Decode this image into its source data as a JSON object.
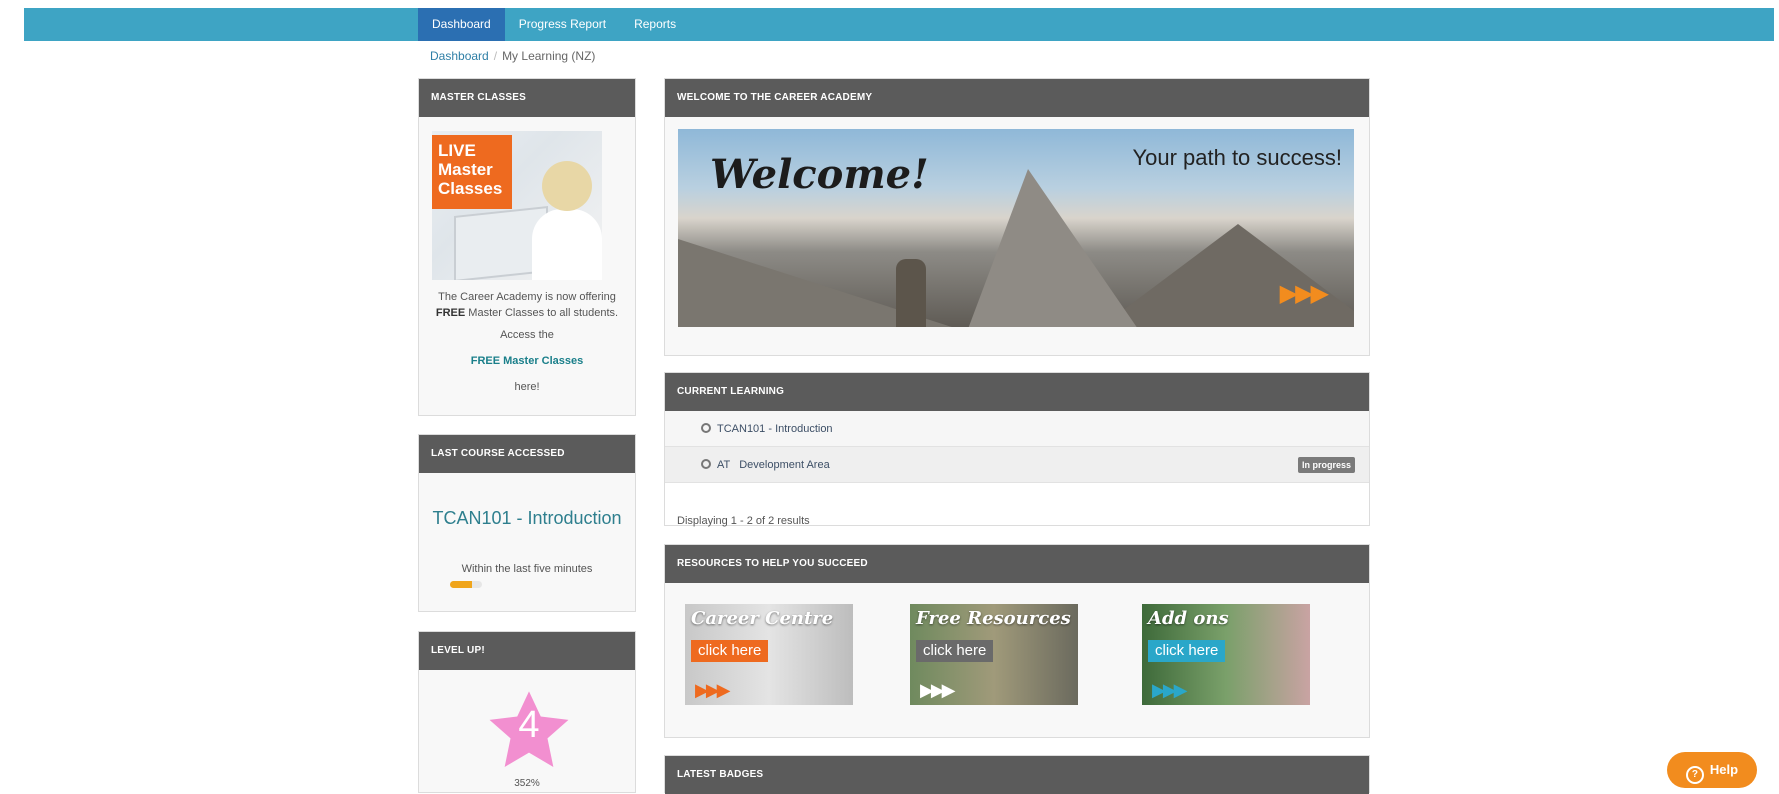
{
  "nav": {
    "items": [
      "Dashboard",
      "Progress Report",
      "Reports"
    ]
  },
  "breadcrumb": {
    "home": "Dashboard",
    "separator": "/",
    "current": "My Learning (NZ)"
  },
  "master_classes": {
    "heading": "MASTER CLASSES",
    "image_badge": "LIVE Master Classes",
    "text_before": "The Career Academy is now offering",
    "text_bold": "FREE",
    "text_after": "Master Classes to all students.",
    "access": "Access the",
    "link": "FREE Master Classes",
    "here": "here!"
  },
  "last_course": {
    "heading": "LAST COURSE ACCESSED",
    "title": "TCAN101 - Introduction",
    "when": "Within the last five minutes",
    "progress_fraction": 0.7
  },
  "level_up": {
    "heading": "LEVEL UP!",
    "level": "4",
    "points": "352%"
  },
  "welcome": {
    "heading": "WELCOME TO THE CAREER ACADEMY",
    "banner_title": "Welcome!",
    "banner_tagline": "Your path to success!",
    "banner_arrows": "▶▶▶"
  },
  "current_learning": {
    "heading": "CURRENT LEARNING",
    "rows": [
      {
        "label": "TCAN101 - Introduction",
        "badge": ""
      },
      {
        "label": "AT   Development Area",
        "badge": "In progress"
      }
    ],
    "count": "Displaying 1 - 2 of 2 results"
  },
  "resources": {
    "heading": "RESOURCES TO HELP YOU SUCCEED",
    "tiles": [
      {
        "title": "Career Centre",
        "button": "click here",
        "arrows": "▶▶▶"
      },
      {
        "title": "Free Resources",
        "button": "click here",
        "arrows": "▶▶▶"
      },
      {
        "title": "Add ons",
        "button": "click here",
        "arrows": "▶▶▶"
      }
    ]
  },
  "latest_badges": {
    "heading": "LATEST BADGES"
  },
  "help": {
    "label": "Help"
  },
  "colors": {
    "accent": "#3ea4c4",
    "orange": "#f28c1e",
    "panel_head": "#5b5b5b",
    "nav_active": "#2b6fb2"
  }
}
